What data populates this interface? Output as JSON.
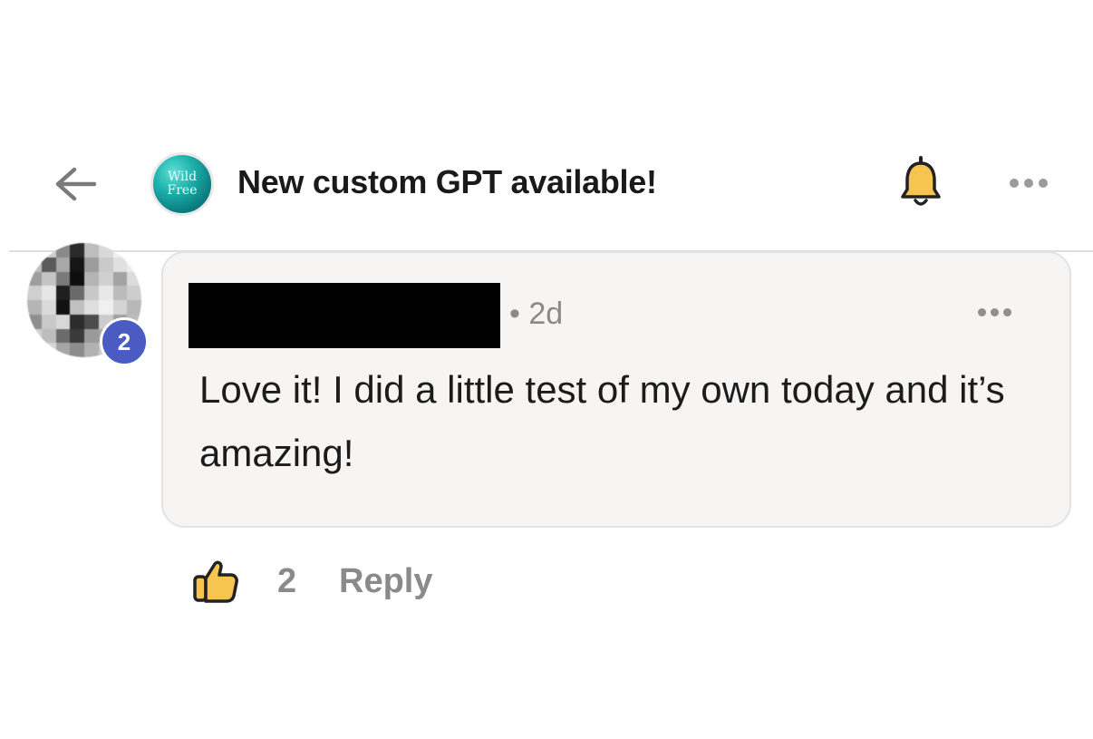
{
  "header": {
    "title": "New custom GPT available!",
    "group_avatar_text": [
      "Wild",
      "Free"
    ],
    "icons": {
      "back": "arrow-left-icon",
      "bell": "bell-icon",
      "more": "more-horizontal-icon"
    }
  },
  "comment": {
    "author_name_redacted": true,
    "meta": "• 2d",
    "text": "Love it! I did a little test of my own today and it’s amazing!",
    "author_level": "2"
  },
  "actions": {
    "like_count": "2",
    "reply_label": "Reply"
  },
  "colors": {
    "accent_teal": "#1fb3ad",
    "bell_yellow": "#f5c451",
    "level_badge": "#4a5bc4",
    "thumb_yellow": "#f5c451",
    "bubble_bg": "#f6f5f4"
  }
}
